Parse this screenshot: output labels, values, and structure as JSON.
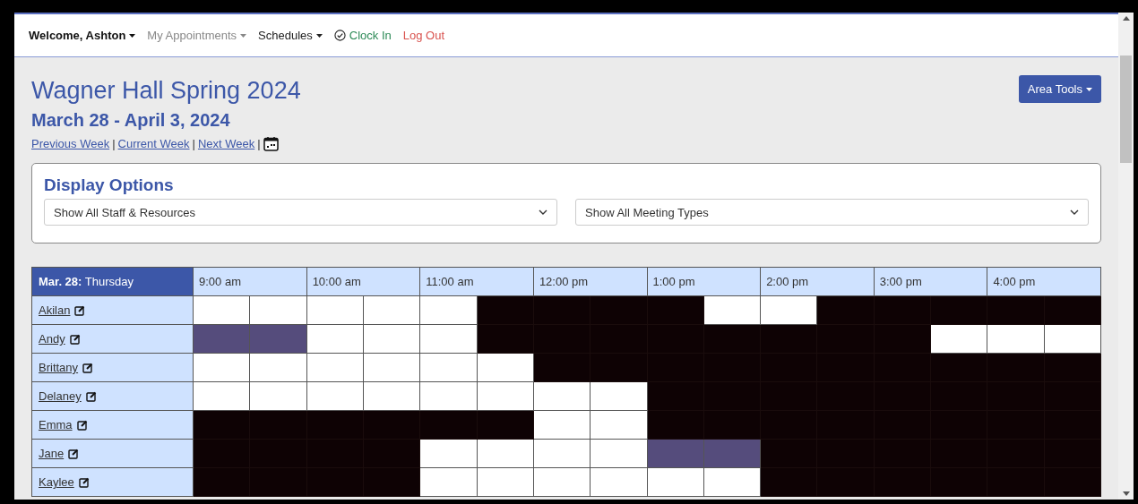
{
  "nav": {
    "welcome": "Welcome, Ashton",
    "appointments": {
      "label": "My Appointments",
      "disabled": true
    },
    "schedules": "Schedules",
    "clock_in": "Clock In",
    "log_out": "Log Out"
  },
  "header": {
    "title": "Wagner Hall Spring 2024",
    "date_range": "March 28 - April 3, 2024",
    "links": [
      {
        "label": "Previous Week",
        "separator": "|"
      },
      {
        "label": "Current Week",
        "separator": "|"
      },
      {
        "label": "Next Week",
        "separator": "|"
      }
    ],
    "area_tools": "Area Tools"
  },
  "display_options": {
    "title": "Display Options",
    "selects": [
      "Show All Staff & Resources",
      "Show All Meeting Types"
    ]
  },
  "schedule": {
    "day": "**Mar. 28:** Thursday",
    "hours": [
      "9:00 am",
      "10:00 am",
      "11:00 am",
      "12:00 pm",
      "1:00 pm",
      "2:00 pm",
      "3:00 pm",
      "4:00 pm"
    ],
    "rows": [
      {
        "name": "Akilan",
        "slots": [
          {
            "kind": "open"
          },
          {
            "kind": "open"
          },
          {
            "kind": "open"
          },
          {
            "kind": "open"
          },
          {
            "kind": "open"
          },
          {
            "kind": "blocked"
          },
          {
            "kind": "blocked"
          },
          {
            "kind": "blocked"
          },
          {
            "kind": "blocked"
          },
          {
            "kind": "open"
          },
          {
            "kind": "open"
          },
          {
            "kind": "blocked"
          },
          {
            "kind": "blocked"
          },
          {
            "kind": "blocked"
          },
          {
            "kind": "blocked"
          },
          {
            "kind": "blocked"
          }
        ]
      },
      {
        "name": "Andy",
        "slots": [
          {
            "kind": "booked"
          },
          {
            "kind": "booked"
          },
          {
            "kind": "open"
          },
          {
            "kind": "open"
          },
          {
            "kind": "open"
          },
          {
            "kind": "blocked"
          },
          {
            "kind": "blocked"
          },
          {
            "kind": "blocked"
          },
          {
            "kind": "blocked"
          },
          {
            "kind": "blocked"
          },
          {
            "kind": "blocked"
          },
          {
            "kind": "blocked"
          },
          {
            "kind": "blocked"
          },
          {
            "kind": "open"
          },
          {
            "kind": "open"
          },
          {
            "kind": "open"
          }
        ]
      },
      {
        "name": "Brittany",
        "slots": [
          {
            "kind": "open"
          },
          {
            "kind": "open"
          },
          {
            "kind": "open"
          },
          {
            "kind": "open"
          },
          {
            "kind": "open"
          },
          {
            "kind": "open"
          },
          {
            "kind": "blocked"
          },
          {
            "kind": "blocked"
          },
          {
            "kind": "blocked"
          },
          {
            "kind": "blocked"
          },
          {
            "kind": "blocked"
          },
          {
            "kind": "blocked"
          },
          {
            "kind": "blocked"
          },
          {
            "kind": "blocked"
          },
          {
            "kind": "blocked"
          },
          {
            "kind": "blocked"
          }
        ]
      },
      {
        "name": "Delaney",
        "slots": [
          {
            "kind": "open"
          },
          {
            "kind": "open"
          },
          {
            "kind": "open"
          },
          {
            "kind": "open"
          },
          {
            "kind": "open"
          },
          {
            "kind": "open"
          },
          {
            "kind": "open"
          },
          {
            "kind": "open"
          },
          {
            "kind": "blocked"
          },
          {
            "kind": "blocked"
          },
          {
            "kind": "blocked"
          },
          {
            "kind": "blocked"
          },
          {
            "kind": "blocked"
          },
          {
            "kind": "blocked"
          },
          {
            "kind": "blocked"
          },
          {
            "kind": "blocked"
          }
        ]
      },
      {
        "name": "Emma",
        "slots": [
          {
            "kind": "blocked"
          },
          {
            "kind": "blocked"
          },
          {
            "kind": "blocked"
          },
          {
            "kind": "blocked"
          },
          {
            "kind": "blocked"
          },
          {
            "kind": "blocked"
          },
          {
            "kind": "open"
          },
          {
            "kind": "open"
          },
          {
            "kind": "blocked"
          },
          {
            "kind": "blocked"
          },
          {
            "kind": "blocked"
          },
          {
            "kind": "blocked"
          },
          {
            "kind": "blocked"
          },
          {
            "kind": "blocked"
          },
          {
            "kind": "blocked"
          },
          {
            "kind": "blocked"
          }
        ]
      },
      {
        "name": "Jane",
        "slots": [
          {
            "kind": "blocked"
          },
          {
            "kind": "blocked"
          },
          {
            "kind": "blocked"
          },
          {
            "kind": "blocked"
          },
          {
            "kind": "open"
          },
          {
            "kind": "open"
          },
          {
            "kind": "open"
          },
          {
            "kind": "open"
          },
          {
            "kind": "booked"
          },
          {
            "kind": "booked"
          },
          {
            "kind": "blocked"
          },
          {
            "kind": "blocked"
          },
          {
            "kind": "blocked"
          },
          {
            "kind": "blocked"
          },
          {
            "kind": "blocked"
          },
          {
            "kind": "blocked"
          }
        ]
      },
      {
        "name": "Kaylee",
        "slots": [
          {
            "kind": "blocked"
          },
          {
            "kind": "blocked"
          },
          {
            "kind": "blocked"
          },
          {
            "kind": "blocked"
          },
          {
            "kind": "open"
          },
          {
            "kind": "open"
          },
          {
            "kind": "open"
          },
          {
            "kind": "open"
          },
          {
            "kind": "open"
          },
          {
            "kind": "open"
          },
          {
            "kind": "blocked"
          },
          {
            "kind": "blocked"
          },
          {
            "kind": "blocked"
          },
          {
            "kind": "blocked"
          },
          {
            "kind": "blocked"
          },
          {
            "kind": "blocked"
          }
        ]
      }
    ]
  }
}
